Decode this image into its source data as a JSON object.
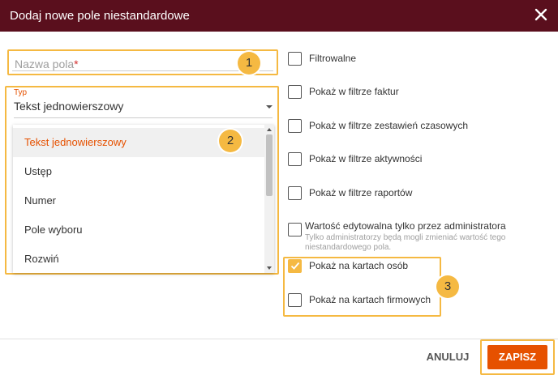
{
  "dialog": {
    "title": "Dodaj nowe pole niestandardowe",
    "close_icon": "close-icon"
  },
  "name_field": {
    "placeholder": "Nazwa pola",
    "required_mark": "*"
  },
  "type_field": {
    "label": "Typ",
    "value": "Tekst jednowierszowy",
    "options": [
      "Tekst jednowierszowy",
      "Ustęp",
      "Numer",
      "Pole wyboru",
      "Rozwiń"
    ]
  },
  "checkboxes": [
    {
      "label": "Filtrowalne",
      "checked": false
    },
    {
      "label": "Pokaż w filtrze faktur",
      "checked": false
    },
    {
      "label": "Pokaż w filtrze zestawień czasowych",
      "checked": false
    },
    {
      "label": "Pokaż w filtrze aktywności",
      "checked": false
    },
    {
      "label": "Pokaż w filtrze raportów",
      "checked": false
    },
    {
      "label": "Wartość edytowalna tylko przez administratora",
      "hint": "Tylko administratorzy będą mogli zmieniać wartość tego niestandardowego pola.",
      "checked": false
    },
    {
      "label": "Pokaż na kartach osób",
      "checked": true
    },
    {
      "label": "Pokaż na kartach firmowych",
      "checked": false
    }
  ],
  "badges": [
    "1",
    "2",
    "3"
  ],
  "footer": {
    "cancel_label": "ANULUJ",
    "save_label": "ZAPISZ"
  },
  "colors": {
    "header_bg": "#5a0f1d",
    "accent": "#e65100",
    "highlight": "#f5b942"
  }
}
